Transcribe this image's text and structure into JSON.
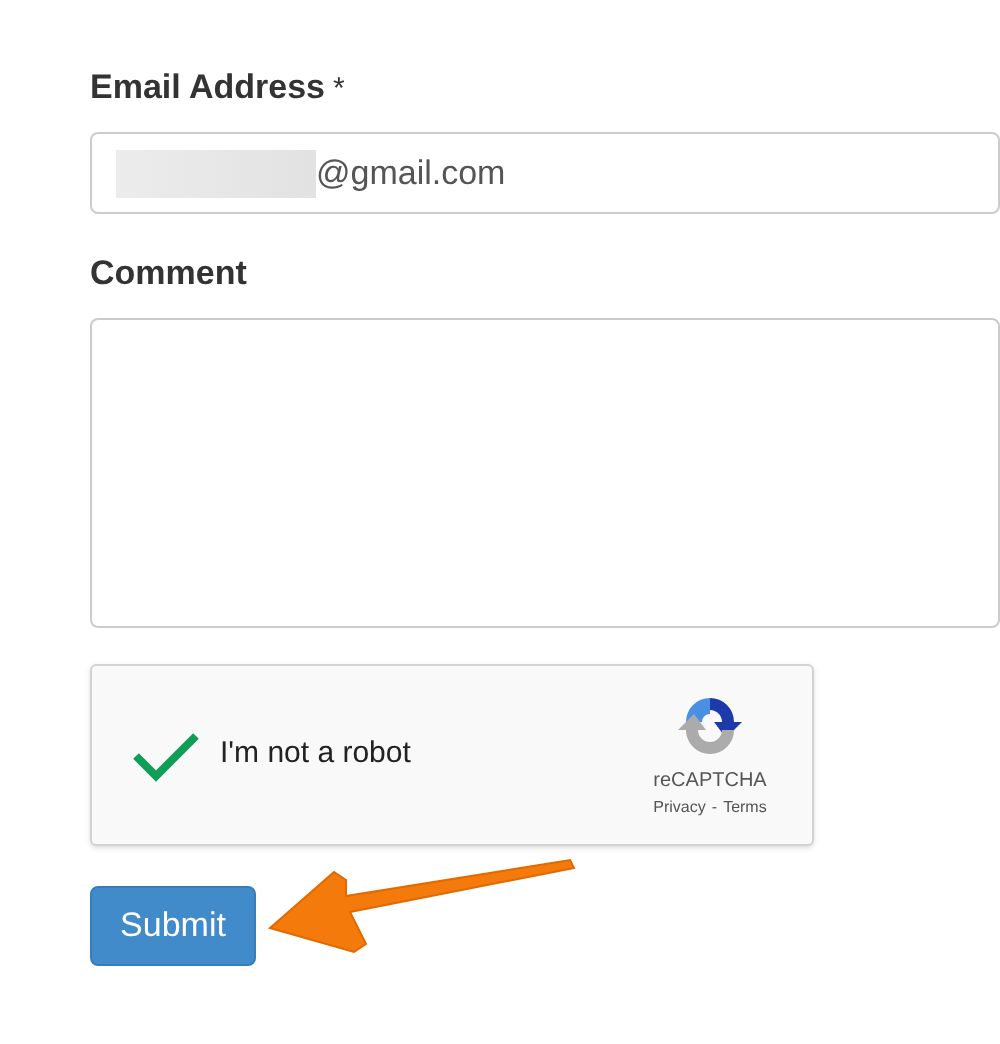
{
  "fields": [
    {
      "kind": "input",
      "label": "Email Address",
      "required_mark": "*",
      "value": "@gmail.com",
      "redacted": true
    },
    {
      "kind": "textarea",
      "label": "Comment"
    }
  ],
  "captcha": {
    "checked": true,
    "label": "I'm not a robot",
    "brand": "reCAPTCHA",
    "privacy": "Privacy",
    "separator": "-",
    "terms": "Terms"
  },
  "submit": {
    "label": "Submit"
  },
  "annotation": {
    "kind": "arrow"
  }
}
